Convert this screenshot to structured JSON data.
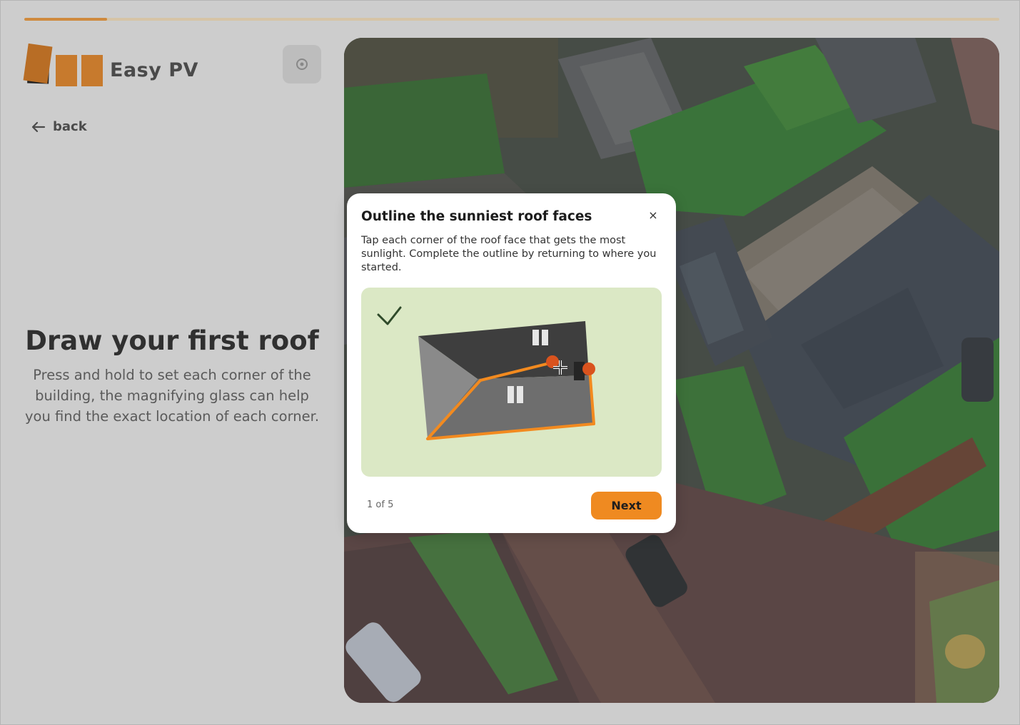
{
  "progress": {
    "fraction": 0.085
  },
  "brand": {
    "name": "Easy PV",
    "logo_icon": "solar-panel-tiles-logo"
  },
  "header": {
    "help_icon": "help-icon"
  },
  "nav": {
    "back_label": "back"
  },
  "main": {
    "title": "Draw your first roof",
    "description": "Press and hold to set each corner of the building, the magnifying glass can help you find the exact location of each corner."
  },
  "modal": {
    "title": "Outline the sunniest roof faces",
    "close_label": "×",
    "body": "Tap each corner of the roof face that gets the most sunlight. Complete the outline by returning to where you started.",
    "step_text": "1 of 5",
    "next_label": "Next"
  },
  "colors": {
    "accent": "#ef8a21",
    "outline": "#f28a1f",
    "corner_dot": "#d9531e",
    "illustration_bg": "#dbe8c5",
    "check": "#2f4a2a"
  }
}
